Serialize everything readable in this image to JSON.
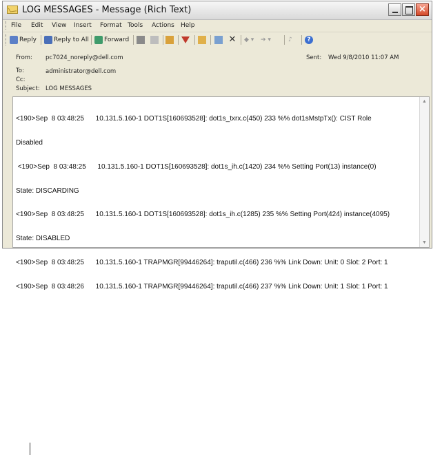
{
  "window": {
    "title": "LOG MESSAGES - Message (Rich Text)"
  },
  "menu": [
    {
      "label": "File"
    },
    {
      "label": "Edit"
    },
    {
      "label": "View"
    },
    {
      "label": "Insert"
    },
    {
      "label": "Format"
    },
    {
      "label": "Tools"
    },
    {
      "label": "Actions"
    },
    {
      "label": "Help"
    }
  ],
  "toolbar": {
    "reply_label": "Reply",
    "reply_all_label": "Reply to All",
    "forward_label": "Forward"
  },
  "header": {
    "from_label": "From:",
    "from_value": "pc7024_noreply@dell.com",
    "sent_label": "Sent:",
    "sent_value": "Wed 9/8/2010 11:07 AM",
    "to_label": "To:",
    "to_value": "administrator@dell.com",
    "cc_label": "Cc:",
    "cc_value": "",
    "subject_label": "Subject:",
    "subject_value": "LOG MESSAGES"
  },
  "body": {
    "lines": [
      "<190>Sep  8 03:48:25      10.131.5.160-1 DOT1S[160693528]: dot1s_txrx.c(450) 233 %% dot1sMstpTx(): CIST Role",
      "Disabled",
      " <190>Sep  8 03:48:25      10.131.5.160-1 DOT1S[160693528]: dot1s_ih.c(1420) 234 %% Setting Port(13) instance(0)",
      "State: DISCARDING",
      "<190>Sep  8 03:48:25      10.131.5.160-1 DOT1S[160693528]: dot1s_ih.c(1285) 235 %% Setting Port(424) instance(4095)",
      "State: DISABLED",
      "<190>Sep  8 03:48:25      10.131.5.160-1 TRAPMGR[99446264]: traputil.c(466) 236 %% Link Down: Unit: 0 Slot: 2 Port: 1",
      "<190>Sep  8 03:48:26      10.131.5.160-1 TRAPMGR[99446264]: traputil.c(466) 237 %% Link Down: Unit: 1 Slot: 1 Port: 1"
    ]
  },
  "icons": {
    "window": "envelope-icon",
    "reply": "reply-icon",
    "reply_all": "reply-all-icon",
    "forward": "forward-icon",
    "print": "print-icon",
    "copy": "copy-icon",
    "flag": "mark-icon",
    "follow_up": "follow-up-flag-icon",
    "home": "home-icon",
    "move": "move-to-folder-icon",
    "delete": "delete-icon",
    "previous": "previous-item-icon",
    "next": "next-item-icon",
    "address_book": "address-book-icon",
    "help": "help-icon"
  }
}
